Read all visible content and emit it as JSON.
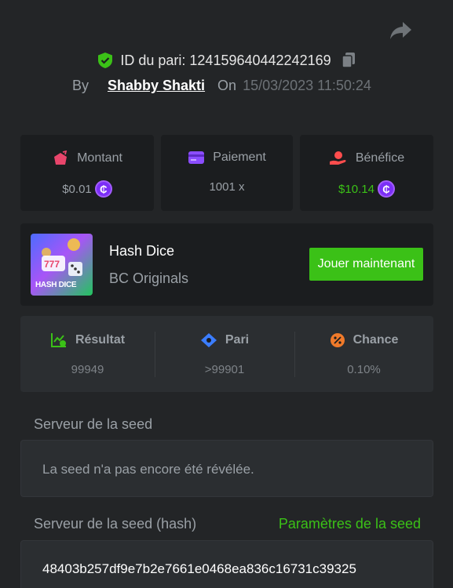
{
  "header": {
    "bet_id_label": "ID du pari: 124159640442242169",
    "by_label": "By",
    "username": "Shabby Shakti",
    "on_label": "On",
    "date": "15/03/2023 11:50:24"
  },
  "stats": {
    "amount": {
      "label": "Montant",
      "value": "$0.01",
      "icon": "money-bag-icon",
      "color": "#e8456b"
    },
    "payout": {
      "label": "Paiement",
      "value": "1001 x",
      "icon": "card-icon",
      "color": "#8b4dff"
    },
    "profit": {
      "label": "Bénéfice",
      "value": "$10.14",
      "icon": "hand-coin-icon",
      "color": "#ff4d4d",
      "value_color": "#3bc117"
    },
    "coin_symbol": "₵"
  },
  "game": {
    "title": "Hash Dice",
    "provider": "BC Originals",
    "thumb_text": "HASH DICE",
    "play_label": "Jouer maintenant"
  },
  "result": {
    "result": {
      "label": "Résultat",
      "value": "99949"
    },
    "bet": {
      "label": "Pari",
      "value": ">99901"
    },
    "chance": {
      "label": "Chance",
      "value": "0.10%"
    }
  },
  "seed": {
    "server_label": "Serveur de la seed",
    "server_value": "La seed n'a pas encore été révélée.",
    "hash_label": "Serveur de la seed (hash)",
    "settings_link": "Paramètres de la seed",
    "hash_value": "48403b257df9e7b2e7661e0468ea836c16731c39325"
  },
  "colors": {
    "background": "#232527",
    "card": "#1b1d1f",
    "accent_green": "#3bc117",
    "coin_purple": "#7b2ff7"
  }
}
